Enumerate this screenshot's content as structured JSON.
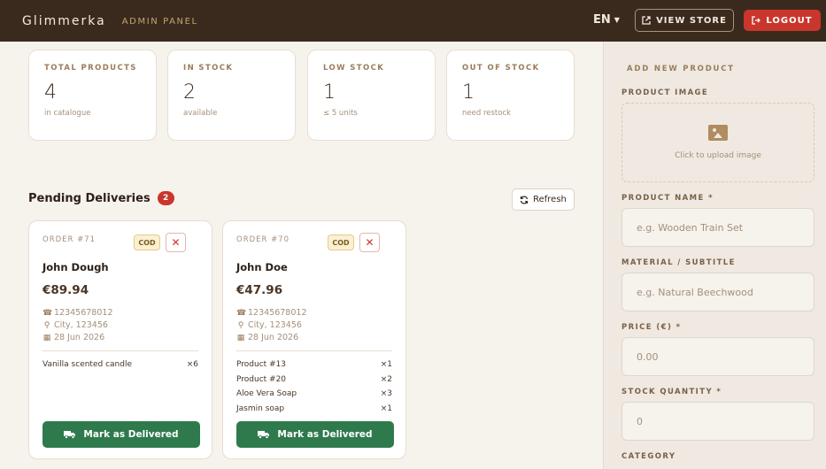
{
  "header": {
    "brand": "Glimmerka",
    "panel_label": "ADMIN PANEL",
    "language": "EN",
    "view_store_label": "VIEW STORE",
    "logout_label": "LOGOUT"
  },
  "stats": [
    {
      "label": "TOTAL PRODUCTS",
      "value": "4",
      "sub": "in catalogue"
    },
    {
      "label": "IN STOCK",
      "value": "2",
      "sub": "available"
    },
    {
      "label": "LOW STOCK",
      "value": "1",
      "sub": "≤ 5 units"
    },
    {
      "label": "OUT OF STOCK",
      "value": "1",
      "sub": "need restock"
    }
  ],
  "pending": {
    "title": "Pending Deliveries",
    "count": "2",
    "refresh_label": "Refresh"
  },
  "orders": [
    {
      "id": "ORDER #71",
      "badge": "COD",
      "name": "John Dough",
      "amount": "€89.94",
      "phone": "12345678012",
      "address": "City, 123456",
      "date": "28 Jun 2026",
      "items": [
        {
          "name": "Vanilla scented candle",
          "qty": "×6"
        }
      ],
      "action_label": "Mark as Delivered"
    },
    {
      "id": "ORDER #70",
      "badge": "COD",
      "name": "John Doe",
      "amount": "€47.96",
      "phone": "12345678012",
      "address": "City, 123456",
      "date": "28 Jun 2026",
      "items": [
        {
          "name": "Product #13",
          "qty": "×1"
        },
        {
          "name": "Product #20",
          "qty": "×2"
        },
        {
          "name": "Aloe Vera Soap",
          "qty": "×3"
        },
        {
          "name": "Jasmin soap",
          "qty": "×1"
        }
      ],
      "action_label": "Mark as Delivered"
    }
  ],
  "form": {
    "title": "ADD NEW PRODUCT",
    "image_label": "PRODUCT IMAGE",
    "upload_text": "Click to upload image",
    "name_label": "PRODUCT NAME *",
    "name_placeholder": "e.g. Wooden Train Set",
    "material_label": "MATERIAL / SUBTITLE",
    "material_placeholder": "e.g. Natural Beechwood",
    "price_label": "PRICE (€) *",
    "price_placeholder": "0.00",
    "stock_label": "STOCK QUANTITY *",
    "stock_placeholder": "0",
    "category_label": "CATEGORY"
  },
  "colors": {
    "header_bg": "#3a2a1e",
    "accent_red": "#c9362c",
    "deliver_green": "#2f7a4d",
    "gold": "#c6a36d"
  },
  "icons": [
    "external-link-icon",
    "logout-icon",
    "refresh-icon",
    "close-icon",
    "phone-icon",
    "location-pin-icon",
    "calendar-icon",
    "truck-icon",
    "image-icon",
    "chevron-down-icon"
  ]
}
